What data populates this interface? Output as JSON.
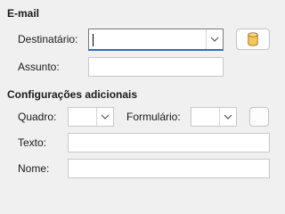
{
  "email": {
    "title": "E-mail",
    "recipient_label": "Destinatário:",
    "recipient_value": "",
    "subject_label": "Assunto:",
    "subject_value": "",
    "address_book_icon": "database-icon"
  },
  "additional": {
    "title": "Configurações adicionais",
    "frame_label": "Quadro:",
    "frame_value": "",
    "form_label": "Formulário:",
    "form_value": "",
    "text_label": "Texto:",
    "text_value": "",
    "name_label": "Nome:",
    "name_value": ""
  },
  "colors": {
    "background": "#f0f0f0",
    "focus_accent": "#2d6fb8",
    "icon_fill": "#f3c75a"
  }
}
